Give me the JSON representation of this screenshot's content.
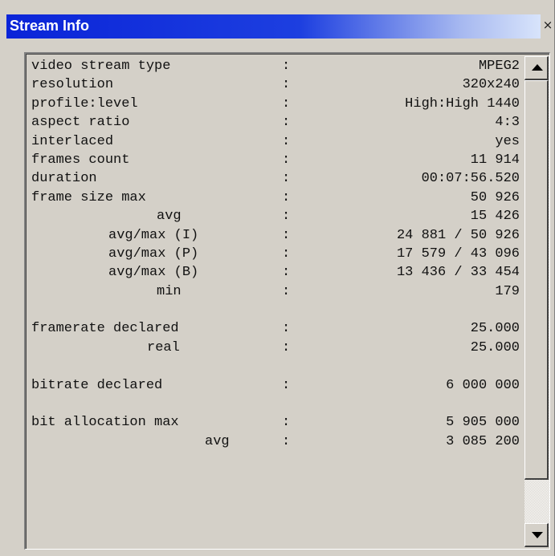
{
  "window": {
    "title": "Stream Info",
    "close_glyph": "×"
  },
  "colors": {
    "titlebar_start": "#0a24d8",
    "titlebar_end": "#d8e4fb",
    "face": "#d4d0c8"
  },
  "rows": [
    {
      "label": "video stream type",
      "value": "MPEG2"
    },
    {
      "label": "resolution",
      "value": "320x240"
    },
    {
      "label": "profile:level",
      "value": "High:High 1440"
    },
    {
      "label": "aspect ratio",
      "value": "4:3"
    },
    {
      "label": "interlaced",
      "value": "yes"
    },
    {
      "label": "frames count",
      "value": "11 914"
    },
    {
      "label": "duration",
      "value": "00:07:56.520"
    },
    {
      "label": "frame size max",
      "value": "50 926"
    },
    {
      "label": "avg",
      "value": "15 426"
    },
    {
      "label": "avg/max (I)",
      "value": "24 881 / 50 926"
    },
    {
      "label": "avg/max (P)",
      "value": "17 579 / 43 096"
    },
    {
      "label": "avg/max (B)",
      "value": "13 436 / 33 454"
    },
    {
      "label": "min",
      "value": "179"
    },
    {
      "label": "framerate declared",
      "value": "25.000"
    },
    {
      "label": "real",
      "value": "25.000"
    },
    {
      "label": "bitrate declared",
      "value": "6 000 000"
    },
    {
      "label": "bit allocation max",
      "value": "5 905 000"
    },
    {
      "label": "avg",
      "value": "3 085 200"
    }
  ],
  "separator": ":",
  "scrollbar": {
    "up_icon": "scroll-up-arrow",
    "down_icon": "scroll-down-arrow"
  }
}
